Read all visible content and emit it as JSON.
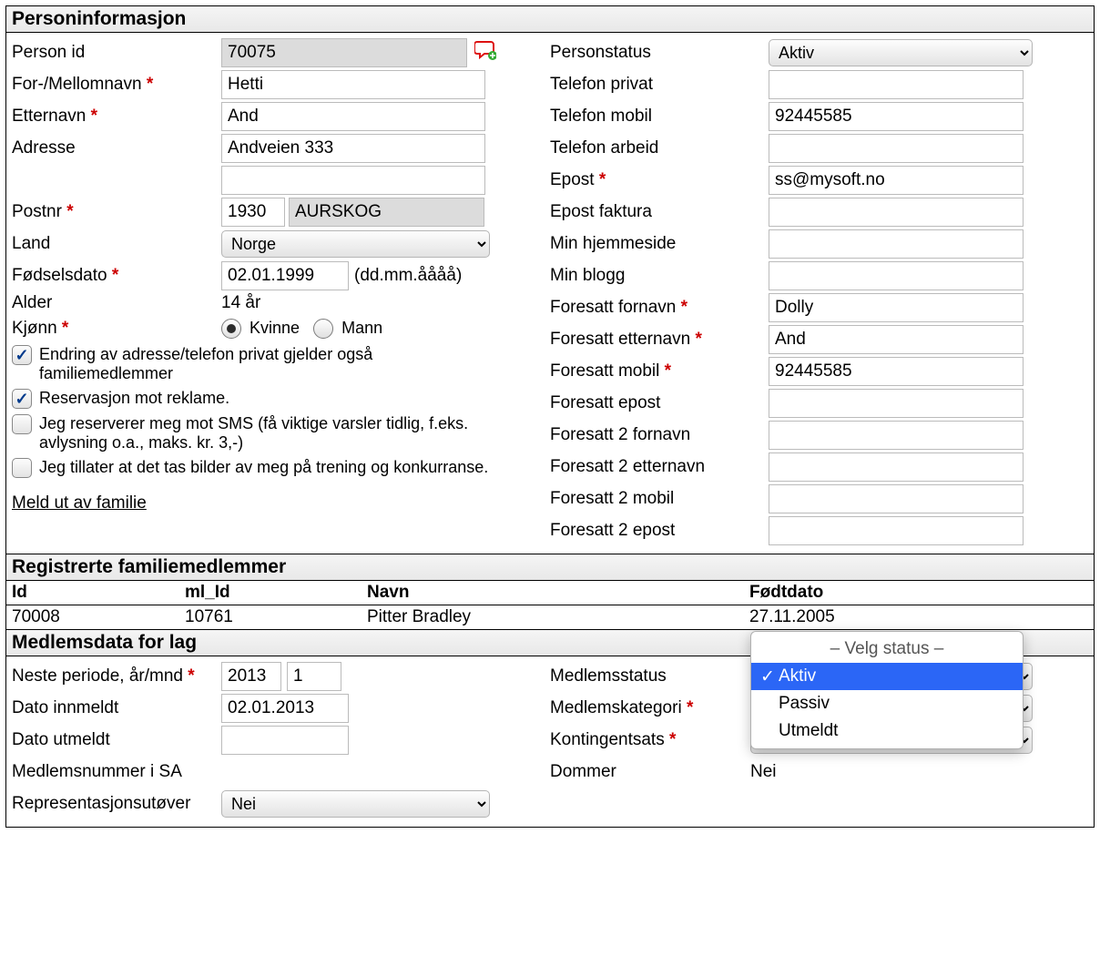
{
  "sections": {
    "person": "Personinformasjon",
    "family": "Registrerte familiemedlemmer",
    "member": "Medlemsdata for lag"
  },
  "labels": {
    "person_id": "Person id",
    "first_middle": "For-/Mellomnavn",
    "lastname": "Etternavn",
    "address": "Adresse",
    "postnr": "Postnr",
    "country": "Land",
    "dob": "Fødselsdato",
    "dob_hint": "(dd.mm.åååå)",
    "age": "Alder",
    "gender": "Kjønn",
    "gender_f": "Kvinne",
    "gender_m": "Mann",
    "chk_family_addr": "Endring av adresse/telefon privat gjelder også familiemedlemmer",
    "chk_reserve_ads": "Reservasjon mot reklame.",
    "chk_reserve_sms": "Jeg reserverer meg mot SMS (få viktige varsler tidlig, f.eks. avlysning o.a., maks. kr. 3,-)",
    "chk_photo": "Jeg tillater at det tas bilder av meg på trening og konkurranse.",
    "unenroll_link": "Meld ut av familie",
    "person_status": "Personstatus",
    "tel_priv": "Telefon privat",
    "tel_mob": "Telefon mobil",
    "tel_work": "Telefon arbeid",
    "email": "Epost",
    "email_inv": "Epost faktura",
    "homepage": "Min hjemmeside",
    "blog": "Min blogg",
    "g1_first": "Foresatt fornavn",
    "g1_last": "Foresatt etternavn",
    "g1_mob": "Foresatt mobil",
    "g1_email": "Foresatt epost",
    "g2_first": "Foresatt 2 fornavn",
    "g2_last": "Foresatt 2 etternavn",
    "g2_mob": "Foresatt 2 mobil",
    "g2_email": "Foresatt 2 epost",
    "next_period": "Neste periode, år/mnd",
    "date_in": "Dato innmeldt",
    "date_out": "Dato utmeldt",
    "member_no": "Medlemsnummer i SA",
    "rep": "Representasjonsutøver",
    "mem_status": "Medlemsstatus",
    "mem_cat": "Medlemskategori",
    "kont": "Kontingentsats",
    "dommer": "Dommer"
  },
  "values": {
    "person_id": "70075",
    "first_middle": "Hetti",
    "lastname": "And",
    "address1": "Andveien 333",
    "address2": "",
    "postnr": "1930",
    "city": "AURSKOG",
    "country": "Norge",
    "dob": "02.01.1999",
    "age": "14 år",
    "person_status": "Aktiv",
    "tel_mob": "92445585",
    "email": "ss@mysoft.no",
    "g1_first": "Dolly",
    "g1_last": "And",
    "g1_mob": "92445585",
    "next_year": "2013",
    "next_month": "1",
    "date_in": "02.01.2013",
    "rep": "Nei",
    "dommer_val": "Nei"
  },
  "family": {
    "h_id": "Id",
    "h_mlid": "ml_Id",
    "h_name": "Navn",
    "h_dob": "Fødtdato",
    "rows": [
      {
        "id": "70008",
        "mlid": "10761",
        "name": "Pitter Bradley",
        "dob": "27.11.2005"
      }
    ]
  },
  "status_dd": {
    "placeholder": "– Velg status –",
    "opt1": "Aktiv",
    "opt2": "Passiv",
    "opt3": "Utmeldt"
  }
}
